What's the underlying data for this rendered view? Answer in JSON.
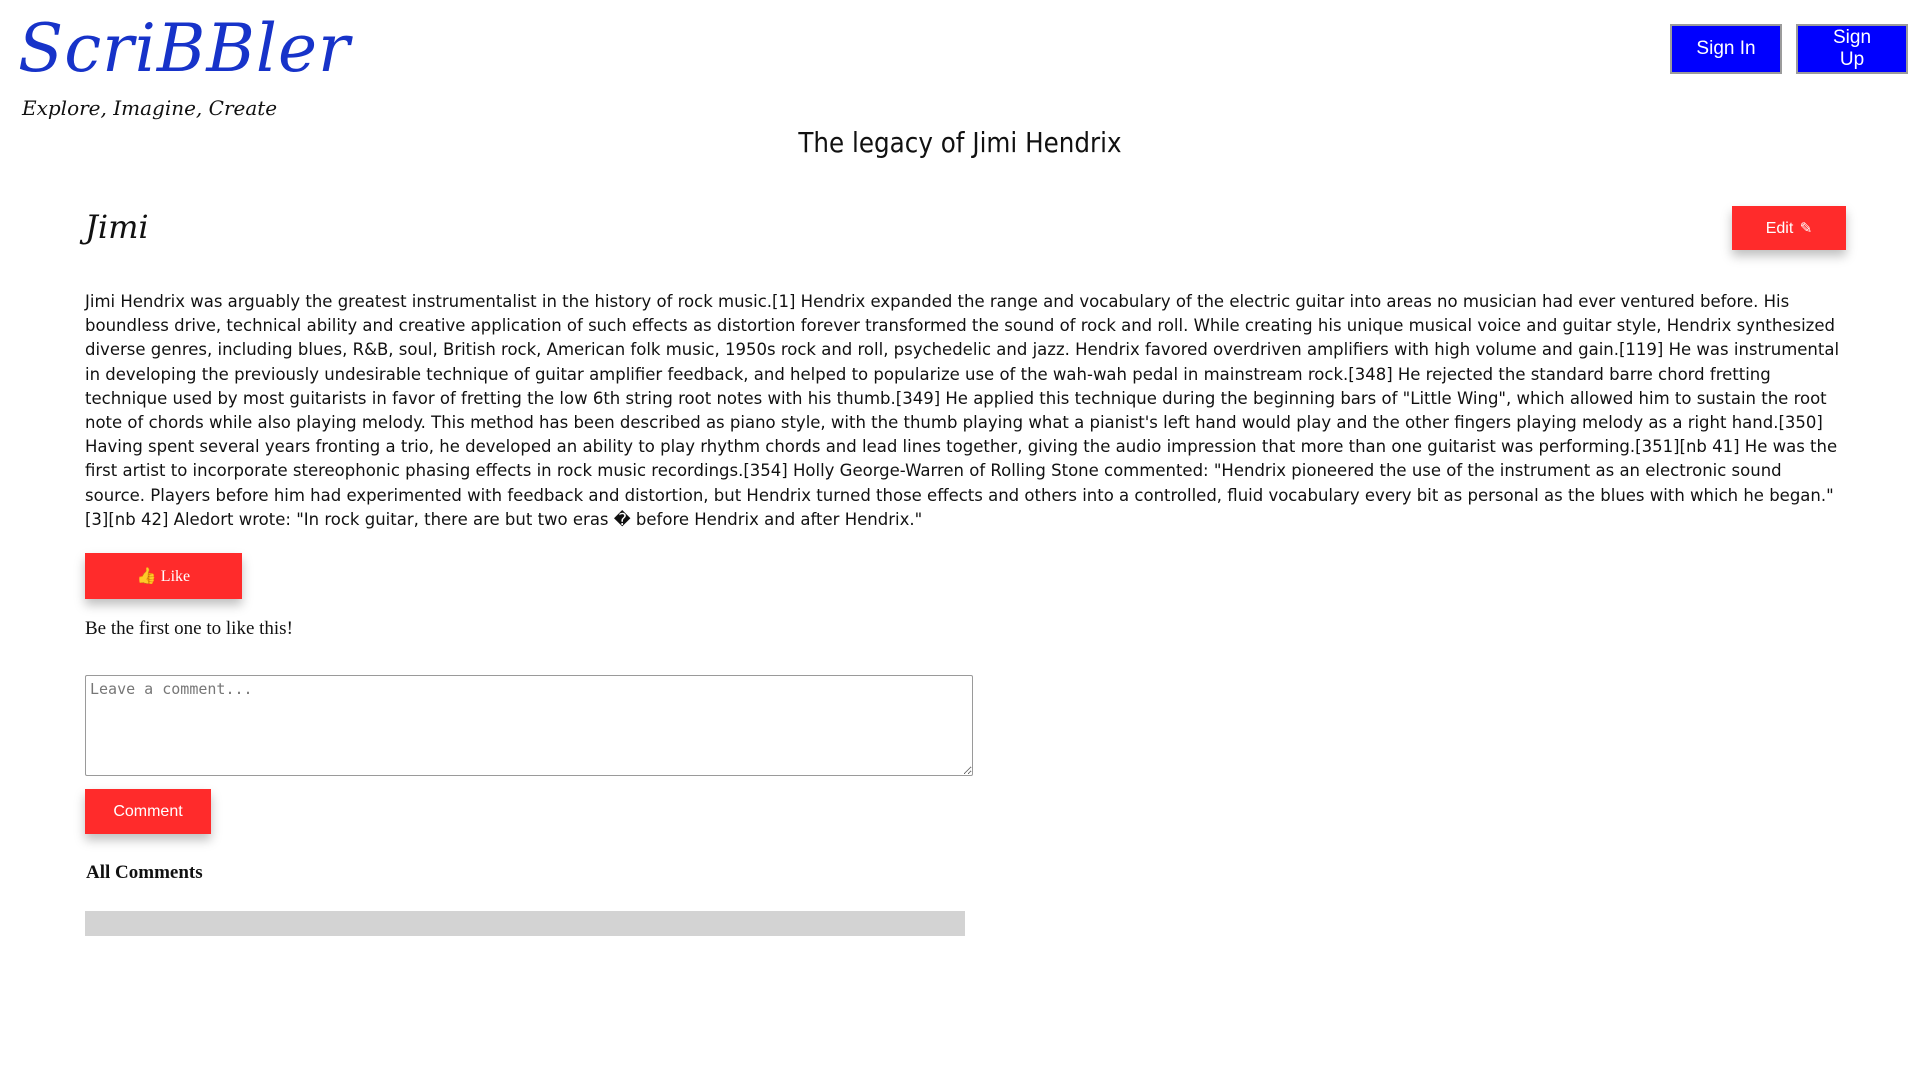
{
  "brand": {
    "logo": "ScriBBler",
    "tagline": "Explore, Imagine, Create"
  },
  "auth": {
    "sign_in": "Sign In",
    "sign_up": "Sign Up"
  },
  "post": {
    "title": "The legacy of Jimi Hendrix",
    "author": "Jimi",
    "edit_label": "Edit",
    "edit_icon": "edit-icon",
    "body": "Jimi Hendrix was arguably the greatest instrumentalist in the history of rock music.[1] Hendrix expanded the range and vocabulary of the electric guitar into areas no musician had ever ventured before. His boundless drive, technical ability and creative application of such effects as distortion forever transformed the sound of rock and roll. While creating his unique musical voice and guitar style, Hendrix synthesized diverse genres, including blues, R&B, soul, British rock, American folk music, 1950s rock and roll, psychedelic and jazz. Hendrix favored overdriven amplifiers with high volume and gain.[119] He was instrumental in developing the previously undesirable technique of guitar amplifier feedback, and helped to popularize use of the wah-wah pedal in mainstream rock.[348] He rejected the standard barre chord fretting technique used by most guitarists in favor of fretting the low 6th string root notes with his thumb.[349] He applied this technique during the beginning bars of \"Little Wing\", which allowed him to sustain the root note of chords while also playing melody. This method has been described as piano style, with the thumb playing what a pianist's left hand would play and the other fingers playing melody as a right hand.[350] Having spent several years fronting a trio, he developed an ability to play rhythm chords and lead lines together, giving the audio impression that more than one guitarist was performing.[351][nb 41] He was the first artist to incorporate stereophonic phasing effects in rock music recordings.[354] Holly George-Warren of Rolling Stone commented: \"Hendrix pioneered the use of the instrument as an electronic sound source. Players before him had experimented with feedback and distortion, but Hendrix turned those effects and others into a controlled, fluid vocabulary every bit as personal as the blues with which he began.\"[3][nb 42] Aledort wrote: \"In rock guitar, there are but two eras � before Hendrix and after Hendrix.\""
  },
  "like": {
    "label": "Like",
    "icon": "thumbs-up-icon",
    "status": "Be the first one to like this!"
  },
  "comment": {
    "placeholder": "Leave a comment...",
    "value": "",
    "button": "Comment"
  },
  "comments": {
    "heading": "All Comments",
    "items": []
  },
  "colors": {
    "accent_red": "#ff2b2b",
    "auth_blue": "#0000ff",
    "logo_blue": "#1733c9",
    "comments_bar": "#d3d3d3"
  }
}
